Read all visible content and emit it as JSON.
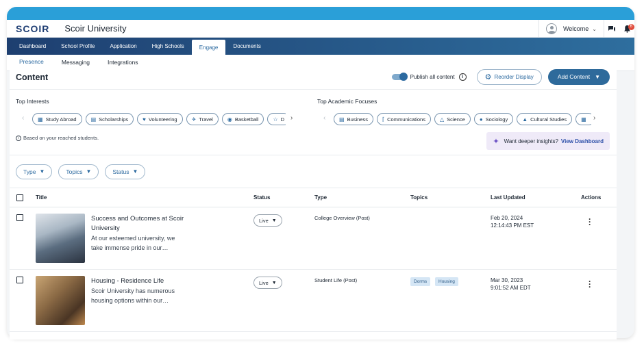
{
  "colors": {
    "accent": "#2c6aa0",
    "nav_start": "#1e3f70",
    "top_strip": "#2a9fd8",
    "badge": "#e04a3a"
  },
  "header": {
    "logo": "SCOIR",
    "university": "Scoir University",
    "welcome": "Welcome",
    "notification_count": "6"
  },
  "nav": {
    "items": [
      "Dashboard",
      "School Profile",
      "Application",
      "High Schools",
      "Engage",
      "Documents"
    ],
    "active": "Engage"
  },
  "subnav": {
    "items": [
      "Presence",
      "Messaging",
      "Integrations"
    ],
    "active": "Presence"
  },
  "content": {
    "title": "Content",
    "publish_label": "Publish all content",
    "publish_on": true,
    "reorder_label": "Reorder Display",
    "add_label": "Add Content"
  },
  "interests": {
    "label": "Top Interests",
    "chips": [
      {
        "icon": "passport-icon",
        "label": "Study Abroad"
      },
      {
        "icon": "chart-icon",
        "label": "Scholarships"
      },
      {
        "icon": "hands-icon",
        "label": "Volunteering"
      },
      {
        "icon": "plane-icon",
        "label": "Travel"
      },
      {
        "icon": "basketball-icon",
        "label": "Basketball"
      },
      {
        "icon": "dance-icon",
        "label": "D"
      }
    ]
  },
  "focuses": {
    "label": "Top Academic Focuses",
    "chips": [
      {
        "icon": "briefcase-icon",
        "label": "Business"
      },
      {
        "icon": "antenna-icon",
        "label": "Communications"
      },
      {
        "icon": "flask-icon",
        "label": "Science"
      },
      {
        "icon": "people-icon",
        "label": "Sociology"
      },
      {
        "icon": "museum-icon",
        "label": "Cultural Studies"
      },
      {
        "icon": "more-icon",
        "label": ""
      }
    ]
  },
  "note": "Based on your reached students.",
  "insights": {
    "prompt": "Want deeper insights?",
    "link": "View Dashboard"
  },
  "filters": [
    "Type",
    "Topics",
    "Status"
  ],
  "table": {
    "columns": [
      "Title",
      "Status",
      "Type",
      "Topics",
      "Last Updated",
      "Actions"
    ],
    "rows": [
      {
        "title": "Success and Outcomes at Scoir University",
        "desc": "At our esteemed university, we take immense pride in our…",
        "status": "Live",
        "type": "College Overview (Post)",
        "topics": [],
        "date": "Feb 20, 2024",
        "time": "12:14:43 PM EST"
      },
      {
        "title": "Housing - Residence Life",
        "desc": "Scoir University has numerous housing options within our…",
        "status": "Live",
        "type": "Student Life (Post)",
        "topics": [
          "Dorms",
          "Housing"
        ],
        "date": "Mar 30, 2023",
        "time": "9:01:52 AM EDT"
      }
    ]
  }
}
